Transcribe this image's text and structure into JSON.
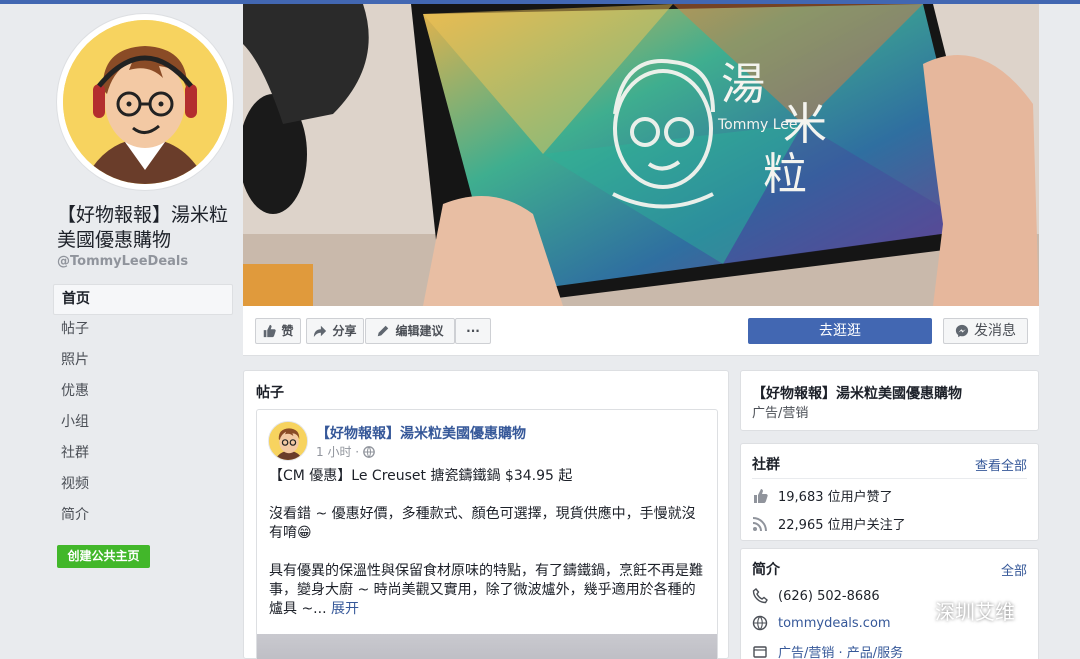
{
  "page": {
    "name": "【好物報報】湯米粒美國優惠購物",
    "handle": "@TommyLeeDeals"
  },
  "nav": {
    "items": [
      {
        "label": "首页"
      },
      {
        "label": "帖子"
      },
      {
        "label": "照片"
      },
      {
        "label": "优惠"
      },
      {
        "label": "小组"
      },
      {
        "label": "社群"
      },
      {
        "label": "视频"
      },
      {
        "label": "简介"
      }
    ],
    "create_label": "创建公共主页"
  },
  "cover": {
    "logo_lines": [
      "湯",
      "米",
      "粒"
    ],
    "logo_sub": "Tommy Lee"
  },
  "actions": {
    "like": "赞",
    "share": "分享",
    "edit": "编辑建议",
    "more": "···",
    "shop": "去逛逛",
    "message": "发消息"
  },
  "posts": {
    "title": "帖子",
    "post": {
      "author": "【好物報報】湯米粒美國優惠購物",
      "time": "1 小时 ·",
      "headline": "【CM 優惠】Le Creuset 搪瓷鑄鐵鍋 $34.95 起",
      "para1": "沒看錯 ~ 優惠好價，多種款式、顏色可選擇，現貨供應中，手慢就沒有唷😁",
      "para2": "具有優異的保溫性與保留食材原味的特點，有了鑄鐵鍋，烹飪不再是難事，變身大廚 ~ 時尚美觀又實用，除了微波爐外，幾乎適用於各種的爐具 ~...",
      "more": "展开"
    }
  },
  "info_card": {
    "title": "【好物報報】湯米粒美國優惠購物",
    "category": "广告/营销"
  },
  "community": {
    "title": "社群",
    "see_all": "查看全部",
    "likes": "19,683 位用户赞了",
    "follows": "22,965 位用户关注了"
  },
  "about": {
    "title": "简介",
    "all": "全部",
    "phone": "(626) 502-8686",
    "website": "tommydeals.com",
    "categories": "广告/营销 · 产品/服务"
  },
  "watermark": {
    "text": "深圳艾维"
  },
  "colors": {
    "brand_blue": "#4267b2",
    "link_blue": "#365899",
    "green": "#42b72a",
    "background": "#e9ebee"
  }
}
